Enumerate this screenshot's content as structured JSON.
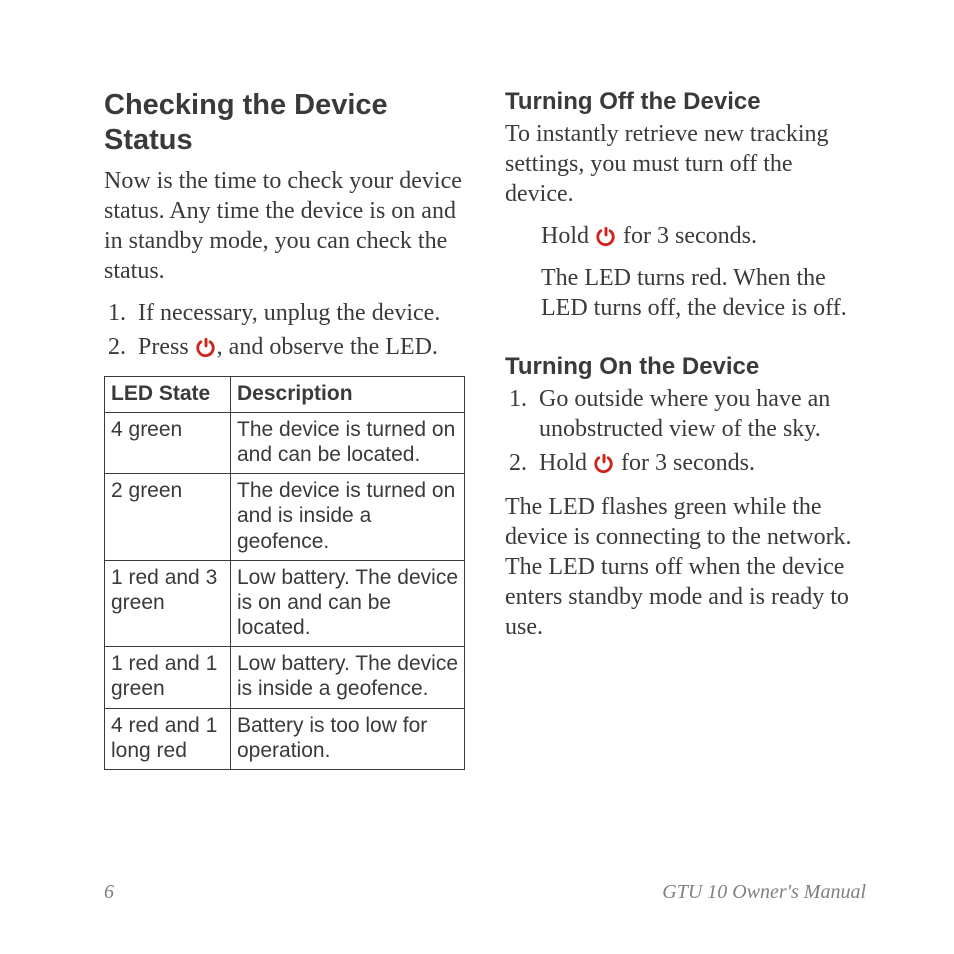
{
  "left": {
    "heading": "Checking the Device Status",
    "intro": "Now is the time to check your device status. Any time the device is on and in standby mode, you can check the status.",
    "step1": "If necessary, unplug the device.",
    "step2a": "Press ",
    "step2b": ", and observe the LED.",
    "table": {
      "h1": "LED State",
      "h2": "Description",
      "rows": [
        {
          "state": "4 green",
          "desc": "The device is turned on and can be located."
        },
        {
          "state": "2 green",
          "desc": "The device is turned on and is inside a geofence."
        },
        {
          "state": "1 red and 3 green",
          "desc": "Low battery. The device is on and can be located."
        },
        {
          "state": "1 red and 1 green",
          "desc": "Low battery. The device is inside a geofence."
        },
        {
          "state": "4 red and 1 long red",
          "desc": "Battery is too low for operation."
        }
      ]
    }
  },
  "right": {
    "off": {
      "heading": "Turning Off the Device",
      "intro": "To instantly retrieve new tracking settings, you must turn off the device.",
      "hold_a": "Hold ",
      "hold_b": " for 3 seconds.",
      "result": "The LED turns red. When the LED turns off, the device is off."
    },
    "on": {
      "heading": "Turning On the Device",
      "step1": "Go outside where you have an unobstructed view of the sky.",
      "step2a": "Hold ",
      "step2b": " for 3 seconds.",
      "after": "The LED flashes green while the device is connecting to the network. The LED turns off when the device enters standby mode and is ready to use."
    }
  },
  "footer": {
    "page": "6",
    "title": "GTU 10 Owner's Manual"
  },
  "icons": {
    "power": "power-icon"
  }
}
